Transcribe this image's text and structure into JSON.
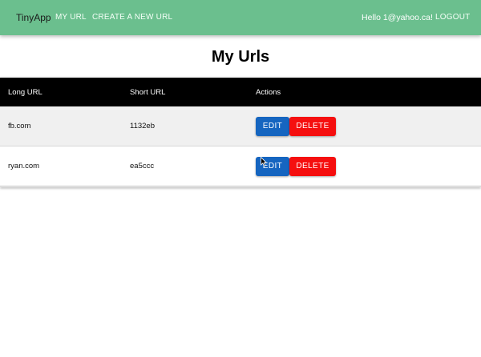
{
  "navbar": {
    "brand": "TinyApp",
    "links": [
      "MY URL",
      "CREATE A NEW URL"
    ],
    "greeting": "Hello 1@yahoo.ca!",
    "logout": "LOGOUT",
    "color": "#6bbf8e"
  },
  "page": {
    "title": "My Urls"
  },
  "table": {
    "headers": [
      "Long URL",
      "Short URL",
      "Actions"
    ],
    "rows": [
      {
        "long_url": "fb.com",
        "short_url": "1132eb",
        "edit": "EDIT",
        "delete": "DELETE"
      },
      {
        "long_url": "ryan.com",
        "short_url": "ea5ccc",
        "edit": "EDIT",
        "delete": "DELETE"
      }
    ]
  },
  "colors": {
    "edit_button": "#1565c0",
    "delete_button": "#f50f0f",
    "header_bg": "#000000"
  },
  "icons": {
    "cursor": "mouse-pointer-icon"
  }
}
